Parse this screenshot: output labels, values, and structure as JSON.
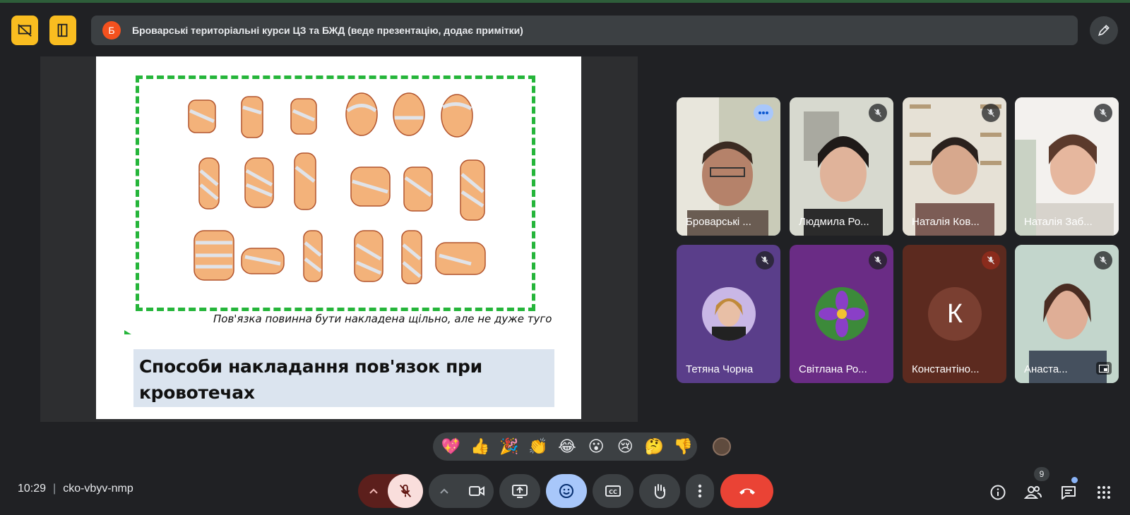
{
  "header": {
    "presenter_initial": "Б",
    "presenter_text": "Броварські територіальні курси ЦЗ та БЖД (веде презентацію, додає примітки)"
  },
  "slide": {
    "caption": "Пов'язка повинна бути накладена щільно, але не дуже туго",
    "title_line1": "Способи накладання пов'язок при",
    "title_line2": "кровотечах"
  },
  "participants": [
    {
      "name": "Броварські ...",
      "muted": false,
      "speaking": true
    },
    {
      "name": "Людмила Ро...",
      "muted": true
    },
    {
      "name": "Наталія Ков...",
      "muted": true
    },
    {
      "name": "Наталія Заб...",
      "muted": true
    },
    {
      "name": "Тетяна Чорна",
      "muted": true
    },
    {
      "name": "Світлана Ро...",
      "muted": true
    },
    {
      "name": "Константіно...",
      "muted": true,
      "initial": "К"
    },
    {
      "name": "Анаста...",
      "muted": true
    }
  ],
  "reactions": [
    "💖",
    "👍",
    "🎉",
    "👏",
    "😂",
    "😮",
    "😢",
    "🤔",
    "👎"
  ],
  "footer": {
    "time": "10:29",
    "meeting_code": "cko-vbyv-nmp",
    "participant_count": "9"
  },
  "colors": {
    "background": "#202124",
    "accent_yellow": "#f9bd20",
    "end_call_red": "#ea4335",
    "emoji_active": "#a8c7fa"
  }
}
